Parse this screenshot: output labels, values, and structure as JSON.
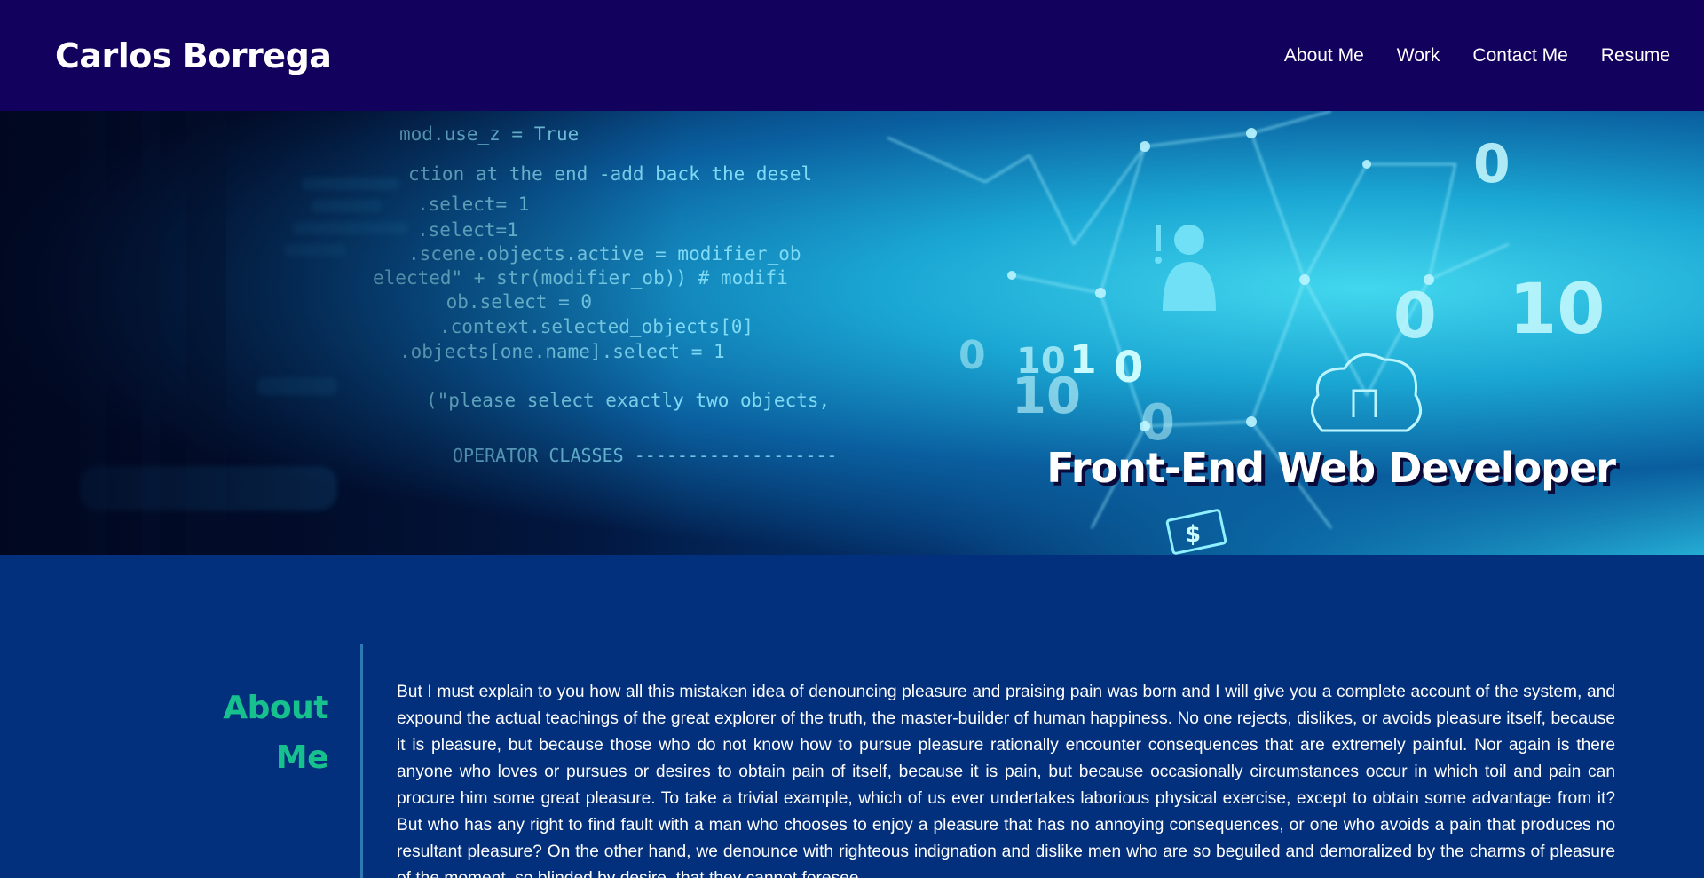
{
  "header": {
    "brand": "Carlos Borrega",
    "nav": [
      {
        "label": "About Me"
      },
      {
        "label": "Work"
      },
      {
        "label": "Contact Me"
      },
      {
        "label": "Resume"
      }
    ]
  },
  "hero": {
    "title": "Front-End Web Developer",
    "code_lines": [
      "mod.use_z = True",
      "ction at the end -add back the desel",
      ".select= 1",
      ".select=1",
      ".scene.objects.active = modifier_ob",
      "elected\" + str(modifier_ob)) # modifi",
      "_ob.select = 0",
      ".context.selected_objects[0]",
      ".objects[one.name].select = 1",
      "(\"please select exactly two objects,",
      "OPERATOR CLASSES -------------------"
    ],
    "digits": [
      "0",
      "10",
      "1",
      "0",
      "10",
      "0",
      "0",
      "10",
      "0",
      "$"
    ]
  },
  "about": {
    "heading_line1": "About",
    "heading_line2": "Me",
    "body": "But I must explain to you how all this mistaken idea of denouncing pleasure and praising pain was born and I will give you a complete account of the system, and expound the actual teachings of the great explorer of the truth, the master-builder of human happiness. No one rejects, dislikes, or avoids pleasure itself, because it is pleasure, but because those who do not know how to pursue pleasure rationally encounter consequences that are extremely painful. Nor again is there anyone who loves or pursues or desires to obtain pain of itself, because it is pain, but because occasionally circumstances occur in which toil and pain can procure him some great pleasure. To take a trivial example, which of us ever undertakes laborious physical exercise, except to obtain some advantage from it? But who has any right to find fault with a man who chooses to enjoy a pleasure that has no annoying consequences, or one who avoids a pain that produces no resultant pleasure? On the other hand, we denounce with righteous indignation and dislike men who are so beguiled and demoralized by the charms of pleasure of the moment, so blinded by desire, that they cannot foresee"
  },
  "colors": {
    "header_bg": "#13015e",
    "page_bg": "#03307c",
    "accent": "#17c18e"
  }
}
